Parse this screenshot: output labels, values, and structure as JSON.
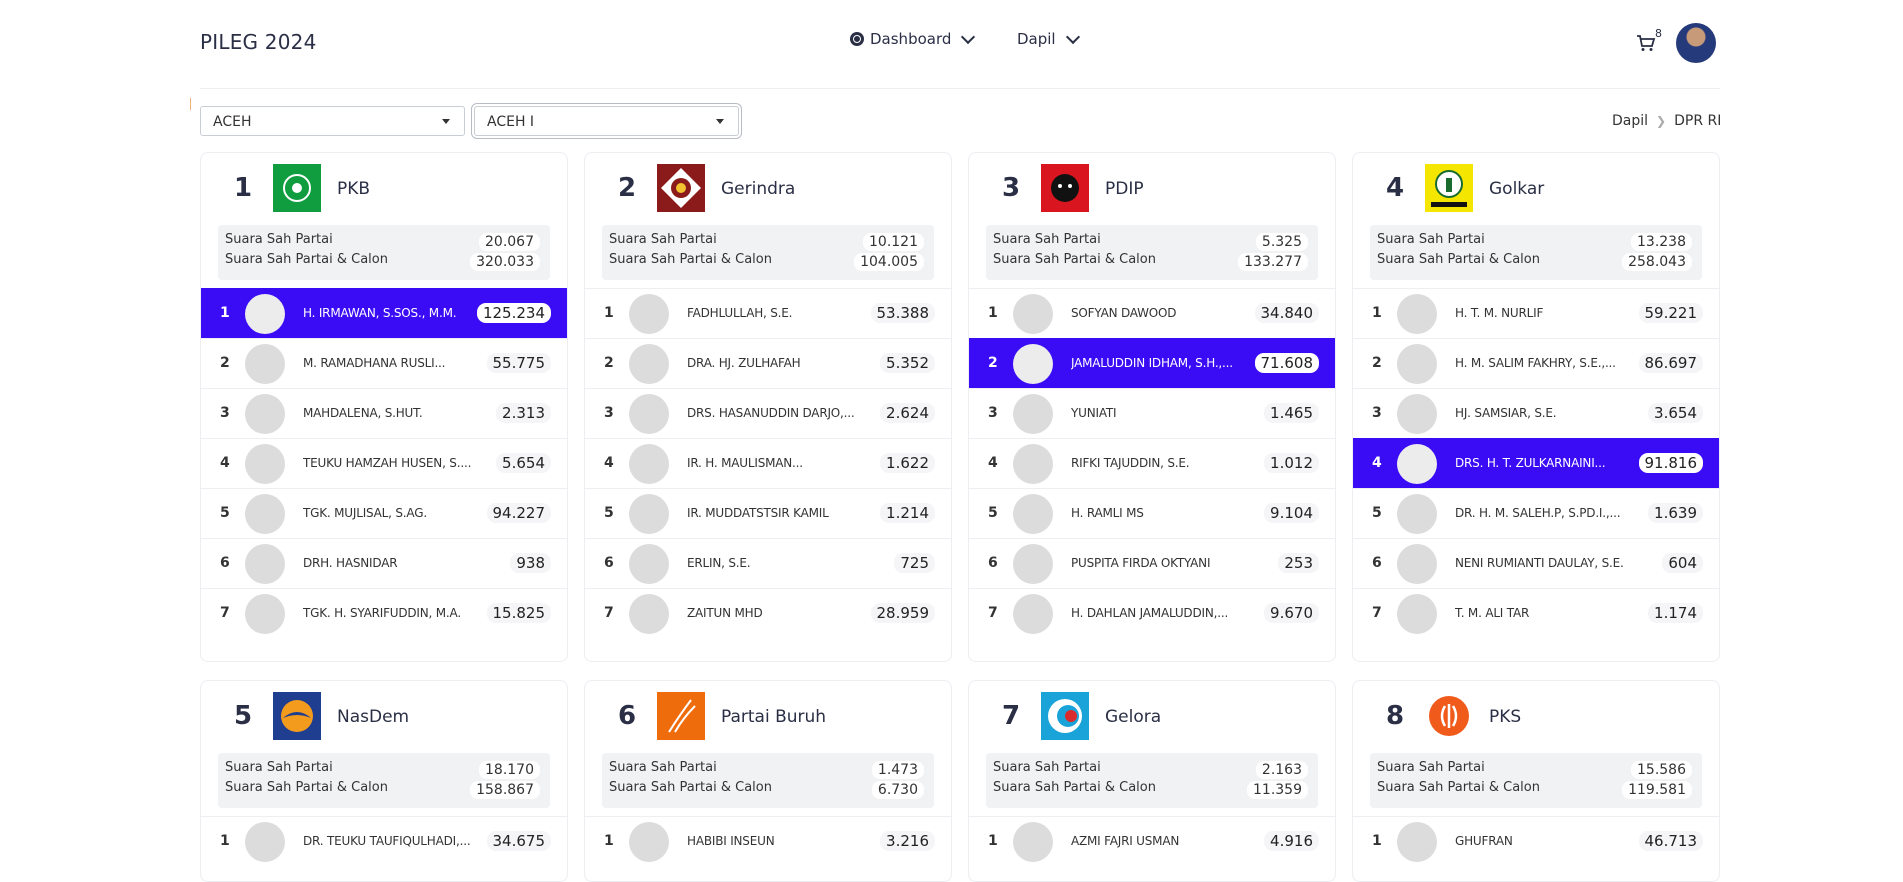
{
  "header": {
    "brand": "PILEG 2024",
    "nav_dashboard": "Dashboard",
    "nav_dapil": "Dapil",
    "cart_count": "8"
  },
  "filters": {
    "province": "ACEH",
    "dapil": "ACEH I"
  },
  "breadcrumb": {
    "item1": "Dapil",
    "item2": "DPR RI"
  },
  "labels": {
    "party_votes": "Suara Sah Partai",
    "party_cand_votes": "Suara Sah Partai & Calon"
  },
  "parties": [
    {
      "num": "1",
      "name": "PKB",
      "party_votes": "20.067",
      "total_votes": "320.033",
      "logo_color": "#0f9d3f",
      "candidates": [
        {
          "n": "1",
          "name": "H. IRMAWAN, S.SOS., M.M.",
          "votes": "125.234",
          "hl": true
        },
        {
          "n": "2",
          "name": "M. RAMADHANA RUSLI...",
          "votes": "55.775"
        },
        {
          "n": "3",
          "name": "MAHDALENA, S.HUT.",
          "votes": "2.313"
        },
        {
          "n": "4",
          "name": "TEUKU HAMZAH HUSEN, S....",
          "votes": "5.654"
        },
        {
          "n": "5",
          "name": "TGK. MUJLISAL, S.AG.",
          "votes": "94.227"
        },
        {
          "n": "6",
          "name": "DRH. HASNIDAR",
          "votes": "938"
        },
        {
          "n": "7",
          "name": "TGK. H. SYARIFUDDIN, M.A.",
          "votes": "15.825"
        }
      ]
    },
    {
      "num": "2",
      "name": "Gerindra",
      "party_votes": "10.121",
      "total_votes": "104.005",
      "logo_color": "#8b1a1a",
      "candidates": [
        {
          "n": "1",
          "name": "FADHLULLAH, S.E.",
          "votes": "53.388"
        },
        {
          "n": "2",
          "name": "DRA. HJ. ZULHAFAH",
          "votes": "5.352"
        },
        {
          "n": "3",
          "name": "DRS. HASANUDDIN DARJO,...",
          "votes": "2.624"
        },
        {
          "n": "4",
          "name": "IR. H. MAULISMAN...",
          "votes": "1.622"
        },
        {
          "n": "5",
          "name": "IR. MUDDATSTSIR KAMIL",
          "votes": "1.214"
        },
        {
          "n": "6",
          "name": "ERLIN, S.E.",
          "votes": "725"
        },
        {
          "n": "7",
          "name": "ZAITUN MHD",
          "votes": "28.959"
        }
      ]
    },
    {
      "num": "3",
      "name": "PDIP",
      "party_votes": "5.325",
      "total_votes": "133.277",
      "logo_color": "#d9161f",
      "candidates": [
        {
          "n": "1",
          "name": "SOFYAN DAWOOD",
          "votes": "34.840"
        },
        {
          "n": "2",
          "name": "JAMALUDDIN IDHAM, S.H.,...",
          "votes": "71.608",
          "hl": true
        },
        {
          "n": "3",
          "name": "YUNIATI",
          "votes": "1.465"
        },
        {
          "n": "4",
          "name": "RIFKI TAJUDDIN, S.E.",
          "votes": "1.012"
        },
        {
          "n": "5",
          "name": "H. RAMLI MS",
          "votes": "9.104"
        },
        {
          "n": "6",
          "name": "PUSPITA FIRDA OKTYANI",
          "votes": "253"
        },
        {
          "n": "7",
          "name": "H. DAHLAN JAMALUDDIN,...",
          "votes": "9.670"
        }
      ]
    },
    {
      "num": "4",
      "name": "Golkar",
      "party_votes": "13.238",
      "total_votes": "258.043",
      "logo_color": "#f5e600",
      "candidates": [
        {
          "n": "1",
          "name": "H. T. M. NURLIF",
          "votes": "59.221"
        },
        {
          "n": "2",
          "name": "H. M. SALIM FAKHRY, S.E.,...",
          "votes": "86.697"
        },
        {
          "n": "3",
          "name": "HJ. SAMSIAR, S.E.",
          "votes": "3.654"
        },
        {
          "n": "4",
          "name": "DRS. H. T. ZULKARNAINI...",
          "votes": "91.816",
          "hl": true
        },
        {
          "n": "5",
          "name": "DR. H. M. SALEH.P, S.PD.I.,...",
          "votes": "1.639"
        },
        {
          "n": "6",
          "name": "NENI RUMIANTI DAULAY, S.E.",
          "votes": "604"
        },
        {
          "n": "7",
          "name": "T. M. ALI TAR",
          "votes": "1.174"
        }
      ]
    },
    {
      "num": "5",
      "name": "NasDem",
      "party_votes": "18.170",
      "total_votes": "158.867",
      "logo_color": "#1f3e8f",
      "candidates": [
        {
          "n": "1",
          "name": "DR. TEUKU TAUFIQULHADI,...",
          "votes": "34.675"
        }
      ]
    },
    {
      "num": "6",
      "name": "Partai Buruh",
      "party_votes": "1.473",
      "total_votes": "6.730",
      "logo_color": "#ef6c0c",
      "candidates": [
        {
          "n": "1",
          "name": "HABIBI INSEUN",
          "votes": "3.216"
        }
      ]
    },
    {
      "num": "7",
      "name": "Gelora",
      "party_votes": "2.163",
      "total_votes": "11.359",
      "logo_color": "#1aa3d8",
      "candidates": [
        {
          "n": "1",
          "name": "AZMI FAJRI USMAN",
          "votes": "4.916"
        }
      ]
    },
    {
      "num": "8",
      "name": "PKS",
      "party_votes": "15.586",
      "total_votes": "119.581",
      "logo_color": "#f05a1a",
      "candidates": [
        {
          "n": "1",
          "name": "GHUFRAN",
          "votes": "46.713"
        }
      ]
    }
  ]
}
